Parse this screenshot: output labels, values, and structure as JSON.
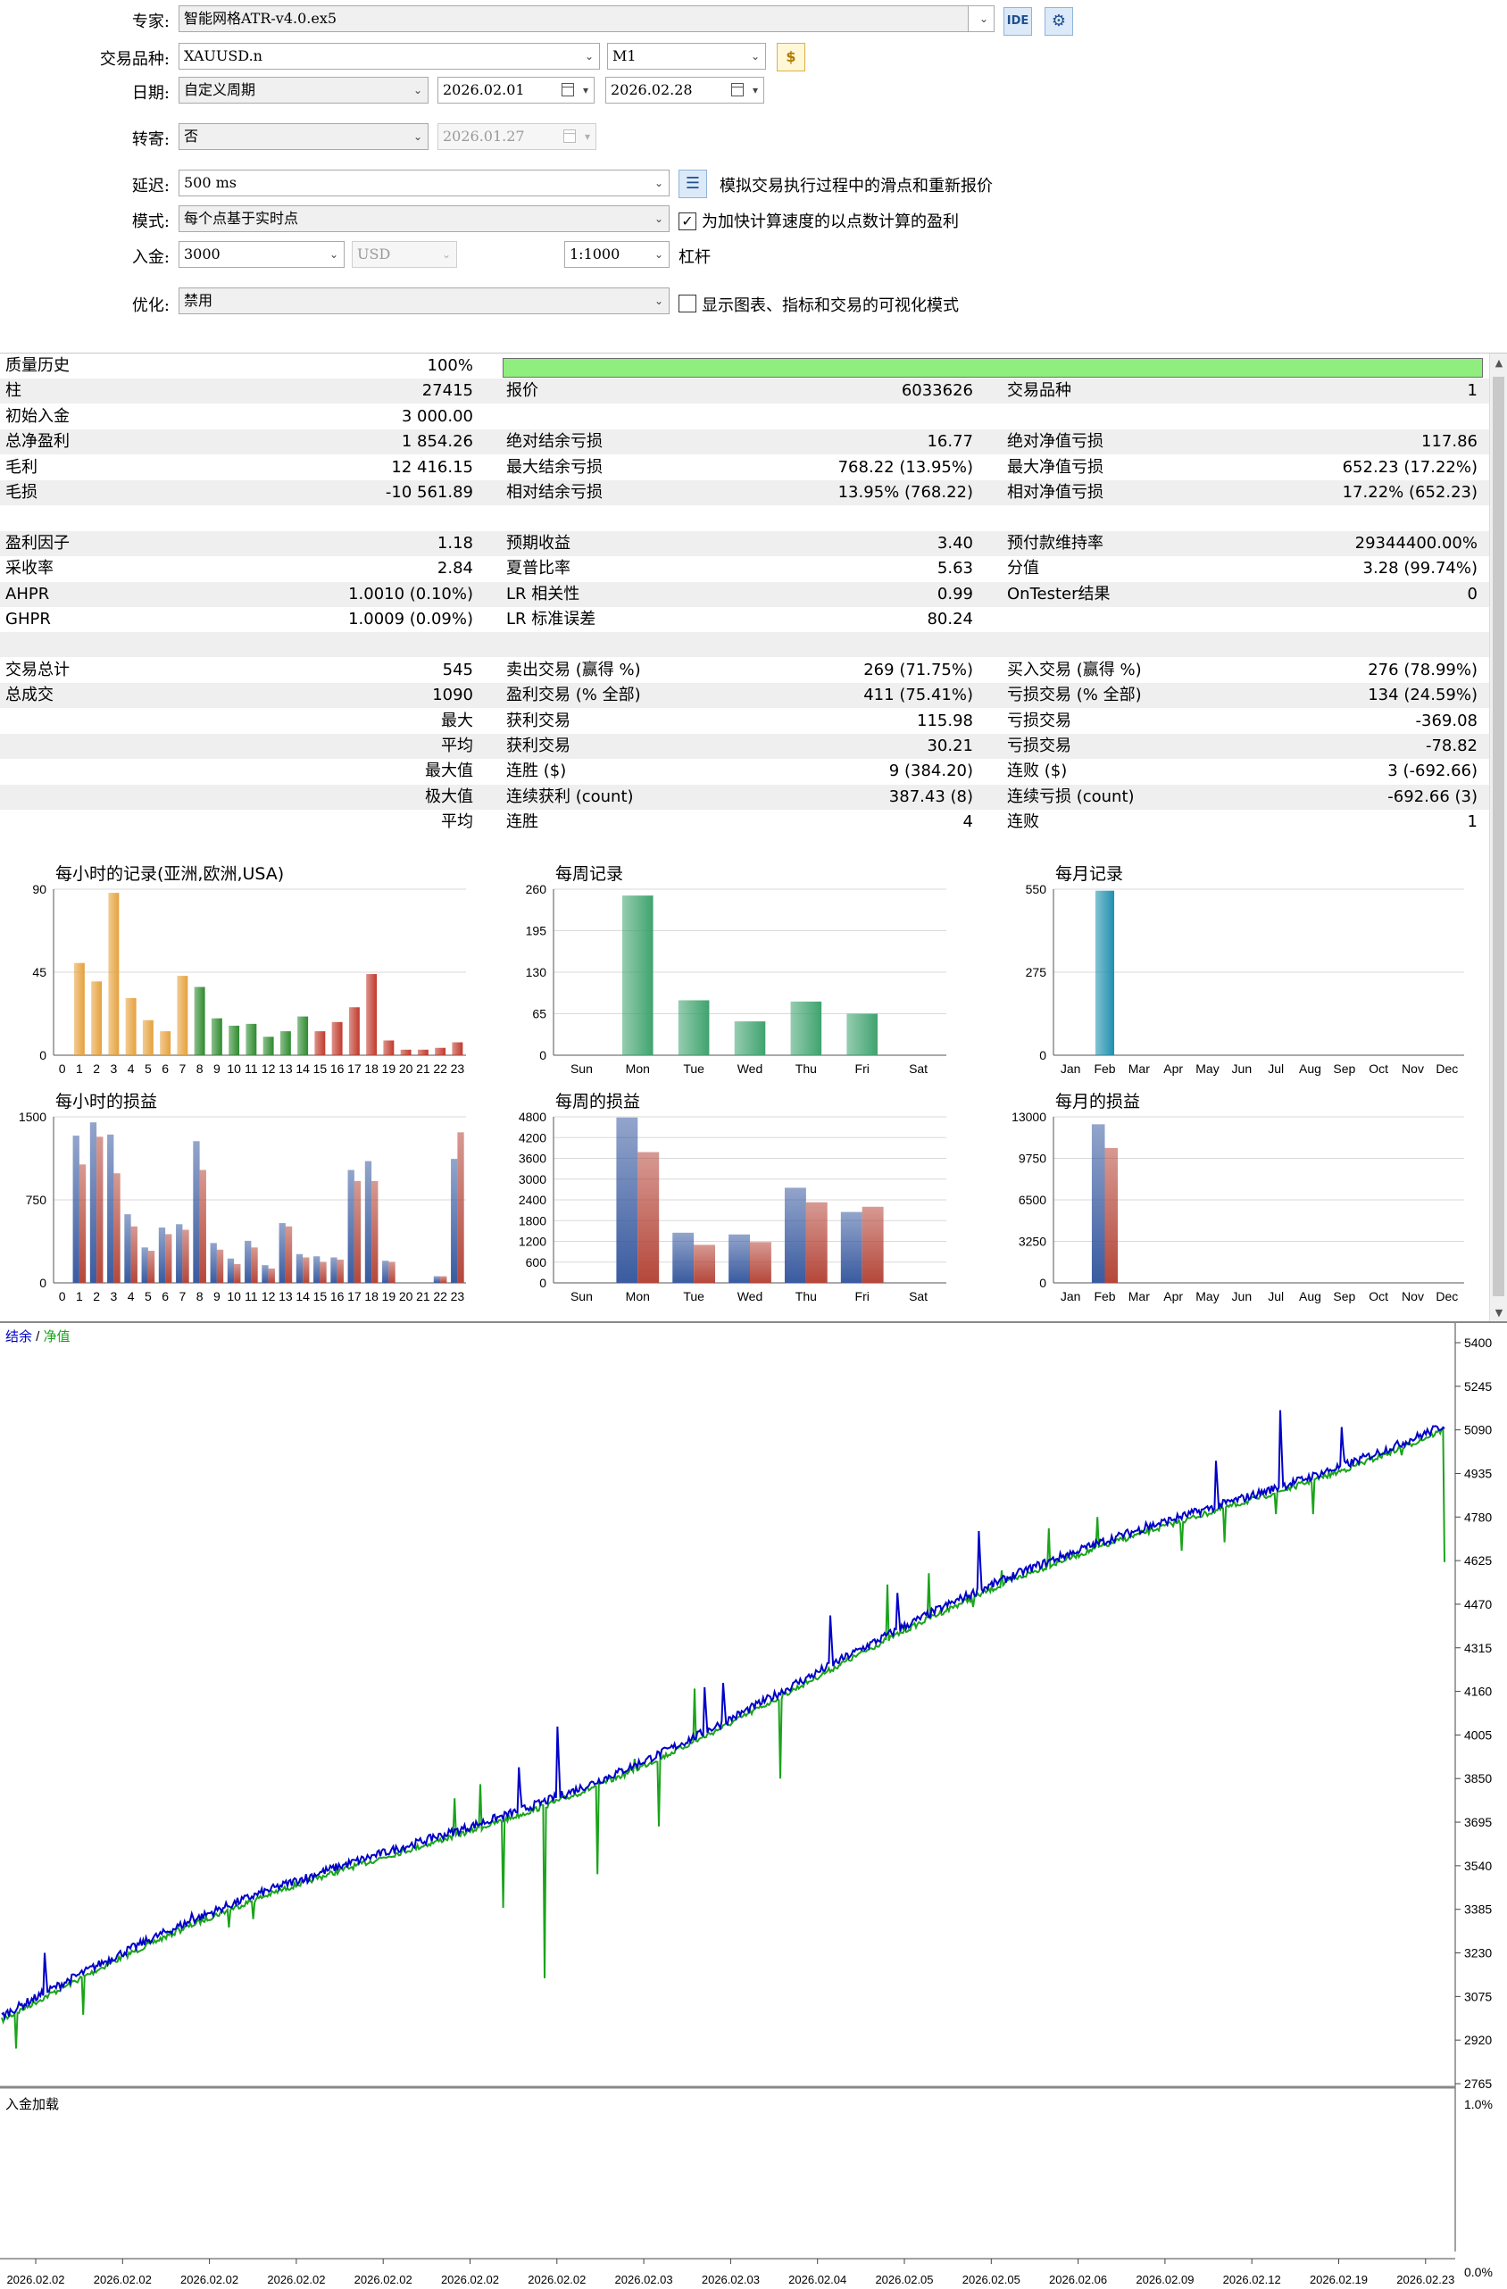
{
  "settings": {
    "expert_label": "专家:",
    "expert_value": "智能网格ATR-v4.0.ex5",
    "ide_label": "IDE",
    "symbol_label": "交易品种:",
    "symbol_value": "XAUUSD.n",
    "timeframe_value": "M1",
    "date_label": "日期:",
    "date_mode": "自定义周期",
    "date_from": "2026.02.01",
    "date_to": "2026.02.28",
    "forward_label": "转寄:",
    "forward_value": "否",
    "forward_date": "2026.01.27",
    "delay_label": "延迟:",
    "delay_value": "500 ms",
    "delay_desc": "模拟交易执行过程中的滑点和重新报价",
    "model_label": "模式:",
    "model_value": "每个点基于实时点",
    "model_check_label": "为加快计算速度的以点数计算的盈利",
    "model_checked": true,
    "deposit_label": "入金:",
    "deposit_value": "3000",
    "currency_value": "USD",
    "leverage_value": "1:1000",
    "leverage_label": "杠杆",
    "optimization_label": "优化:",
    "optimization_value": "禁用",
    "visual_label": "显示图表、指标和交易的可视化模式",
    "visual_checked": false
  },
  "stats": {
    "quality": {
      "label": "质量历史",
      "value": "100%",
      "fill": 1.0
    },
    "rows": [
      {
        "c1l": "柱",
        "c1v": "27415",
        "c2l": "报价",
        "c2v": "6033626",
        "c3l": "交易品种",
        "c3v": "1"
      },
      {
        "c1l": "初始入金",
        "c1v": "3 000.00",
        "c2l": "",
        "c2v": "",
        "c3l": "",
        "c3v": ""
      },
      {
        "c1l": "总净盈利",
        "c1v": "1 854.26",
        "c2l": "绝对结余亏损",
        "c2v": "16.77",
        "c3l": "绝对净值亏损",
        "c3v": "117.86"
      },
      {
        "c1l": "毛利",
        "c1v": "12 416.15",
        "c2l": "最大结余亏损",
        "c2v": "768.22 (13.95%)",
        "c3l": "最大净值亏损",
        "c3v": "652.23 (17.22%)"
      },
      {
        "c1l": "毛损",
        "c1v": "-10 561.89",
        "c2l": "相对结余亏损",
        "c2v": "13.95% (768.22)",
        "c3l": "相对净值亏损",
        "c3v": "17.22% (652.23)"
      },
      {
        "c1l": "",
        "c1v": "",
        "c2l": "",
        "c2v": "",
        "c3l": "",
        "c3v": ""
      },
      {
        "c1l": "盈利因子",
        "c1v": "1.18",
        "c2l": "预期收益",
        "c2v": "3.40",
        "c3l": "预付款维持率",
        "c3v": "29344400.00%"
      },
      {
        "c1l": "采收率",
        "c1v": "2.84",
        "c2l": "夏普比率",
        "c2v": "5.63",
        "c3l": "分值",
        "c3v": "3.28 (99.74%)"
      },
      {
        "c1l": "AHPR",
        "c1v": "1.0010 (0.10%)",
        "c2l": "LR 相关性",
        "c2v": "0.99",
        "c3l": "OnTester结果",
        "c3v": "0"
      },
      {
        "c1l": "GHPR",
        "c1v": "1.0009 (0.09%)",
        "c2l": "LR 标准误差",
        "c2v": "80.24",
        "c3l": "",
        "c3v": ""
      },
      {
        "c1l": "",
        "c1v": "",
        "c2l": "",
        "c2v": "",
        "c3l": "",
        "c3v": ""
      },
      {
        "c1l": "交易总计",
        "c1v": "545",
        "c2l": "卖出交易 (赢得 %)",
        "c2v": "269 (71.75%)",
        "c3l": "买入交易 (赢得 %)",
        "c3v": "276 (78.99%)"
      },
      {
        "c1l": "总成交",
        "c1v": "1090",
        "c2l": "盈利交易 (% 全部)",
        "c2v": "411 (75.41%)",
        "c3l": "亏损交易 (% 全部)",
        "c3v": "134 (24.59%)"
      },
      {
        "c1l": "",
        "c1v": "最大",
        "c2l": "获利交易",
        "c2v": "115.98",
        "c3l": "亏损交易",
        "c3v": "-369.08"
      },
      {
        "c1l": "",
        "c1v": "平均",
        "c2l": "获利交易",
        "c2v": "30.21",
        "c3l": "亏损交易",
        "c3v": "-78.82"
      },
      {
        "c1l": "",
        "c1v": "最大值",
        "c2l": "连胜 ($)",
        "c2v": "9 (384.20)",
        "c3l": "连败 ($)",
        "c3v": "3 (-692.66)"
      },
      {
        "c1l": "",
        "c1v": "极大值",
        "c2l": "连续获利 (count)",
        "c2v": "387.43 (8)",
        "c3l": "连续亏损 (count)",
        "c3v": "-692.66 (3)"
      },
      {
        "c1l": "",
        "c1v": "平均",
        "c2l": "连胜",
        "c2v": "4",
        "c3l": "连败",
        "c3v": "1"
      }
    ]
  },
  "chart_data": [
    {
      "type": "bar",
      "title": "每小时的记录(亚洲,欧洲,USA)",
      "categories": [
        "0",
        "1",
        "2",
        "3",
        "4",
        "5",
        "6",
        "7",
        "8",
        "9",
        "10",
        "11",
        "12",
        "13",
        "14",
        "15",
        "16",
        "17",
        "18",
        "19",
        "20",
        "21",
        "22",
        "23"
      ],
      "yticks": [
        "0",
        "45",
        "90"
      ],
      "ylim": [
        0,
        90
      ],
      "values": [
        0,
        50,
        40,
        88,
        31,
        19,
        13,
        43,
        37,
        20,
        16,
        17,
        10,
        13,
        21,
        13,
        18,
        26,
        44,
        8,
        3,
        3,
        4,
        7
      ],
      "colors": [
        "#e5a13c",
        "#e5a13c",
        "#e5a13c",
        "#e5a13c",
        "#e5a13c",
        "#e5a13c",
        "#e5a13c",
        "#e5a13c",
        "#2e8a2e",
        "#2e8a2e",
        "#2e8a2e",
        "#2e8a2e",
        "#2e8a2e",
        "#2e8a2e",
        "#2e8a2e",
        "#c0392b",
        "#c0392b",
        "#c0392b",
        "#c0392b",
        "#c0392b",
        "#c0392b",
        "#c0392b",
        "#c0392b",
        "#c0392b"
      ]
    },
    {
      "type": "bar",
      "title": "每周记录",
      "categories": [
        "Sun",
        "Mon",
        "Tue",
        "Wed",
        "Thu",
        "Fri",
        "Sat"
      ],
      "yticks": [
        "0",
        "65",
        "130",
        "195",
        "260"
      ],
      "ylim": [
        0,
        260
      ],
      "values": [
        0,
        250,
        86,
        53,
        84,
        65,
        0
      ],
      "colors": [
        "#3fa36e",
        "#3fa36e",
        "#3fa36e",
        "#3fa36e",
        "#3fa36e",
        "#3fa36e",
        "#3fa36e"
      ]
    },
    {
      "type": "bar",
      "title": "每月记录",
      "categories": [
        "Jan",
        "Feb",
        "Mar",
        "Apr",
        "May",
        "Jun",
        "Jul",
        "Aug",
        "Sep",
        "Oct",
        "Nov",
        "Dec"
      ],
      "yticks": [
        "0",
        "275",
        "550"
      ],
      "ylim": [
        0,
        550
      ],
      "values": [
        0,
        545,
        0,
        0,
        0,
        0,
        0,
        0,
        0,
        0,
        0,
        0
      ],
      "colors": [
        "#1f8fae",
        "#1f8fae",
        "#1f8fae",
        "#1f8fae",
        "#1f8fae",
        "#1f8fae",
        "#1f8fae",
        "#1f8fae",
        "#1f8fae",
        "#1f8fae",
        "#1f8fae",
        "#1f8fae"
      ]
    },
    {
      "type": "bar",
      "title": "每小时的损益",
      "categories": [
        "0",
        "1",
        "2",
        "3",
        "4",
        "5",
        "6",
        "7",
        "8",
        "9",
        "10",
        "11",
        "12",
        "13",
        "14",
        "15",
        "16",
        "17",
        "18",
        "19",
        "20",
        "21",
        "22",
        "23"
      ],
      "yticks": [
        "0",
        "750",
        "1500"
      ],
      "ylim": [
        0,
        1500
      ],
      "series": [
        {
          "name": "",
          "color": "#3a5ba0",
          "values": [
            0,
            1330,
            1450,
            1340,
            620,
            320,
            500,
            530,
            1280,
            360,
            220,
            380,
            160,
            540,
            260,
            240,
            230,
            1020,
            1100,
            200,
            0,
            0,
            60,
            1120
          ]
        },
        {
          "name": "",
          "color": "#b5473a",
          "values": [
            0,
            1070,
            1320,
            990,
            510,
            290,
            440,
            480,
            1020,
            300,
            170,
            320,
            130,
            510,
            230,
            190,
            210,
            920,
            920,
            190,
            0,
            0,
            60,
            1360
          ]
        }
      ]
    },
    {
      "type": "bar",
      "title": "每周的损益",
      "categories": [
        "Sun",
        "Mon",
        "Tue",
        "Wed",
        "Thu",
        "Fri",
        "Sat"
      ],
      "yticks": [
        "0",
        "600",
        "1200",
        "1800",
        "2400",
        "3000",
        "3600",
        "4200",
        "4800"
      ],
      "ylim": [
        0,
        4800
      ],
      "series": [
        {
          "name": "",
          "color": "#3a5ba0",
          "values": [
            0,
            4780,
            1450,
            1400,
            2750,
            2050,
            0
          ]
        },
        {
          "name": "",
          "color": "#b5473a",
          "values": [
            0,
            3780,
            1100,
            1180,
            2330,
            2200,
            0
          ]
        }
      ]
    },
    {
      "type": "bar",
      "title": "每月的损益",
      "categories": [
        "Jan",
        "Feb",
        "Mar",
        "Apr",
        "May",
        "Jun",
        "Jul",
        "Aug",
        "Sep",
        "Oct",
        "Nov",
        "Dec"
      ],
      "yticks": [
        "0",
        "3250",
        "6500",
        "9750",
        "13000"
      ],
      "ylim": [
        0,
        13000
      ],
      "series": [
        {
          "name": "",
          "color": "#3a5ba0",
          "values": [
            0,
            12416,
            0,
            0,
            0,
            0,
            0,
            0,
            0,
            0,
            0,
            0
          ]
        },
        {
          "name": "",
          "color": "#b5473a",
          "values": [
            0,
            10562,
            0,
            0,
            0,
            0,
            0,
            0,
            0,
            0,
            0,
            0
          ]
        }
      ]
    },
    {
      "type": "line",
      "title": "结余 / 净值",
      "legend": [
        {
          "name": "结余",
          "color": "#0000c8"
        },
        {
          "name": "净值",
          "color": "#1aa41a"
        }
      ],
      "ylim": [
        2765,
        5400
      ],
      "yticks": [
        "5400",
        "5245",
        "5090",
        "4935",
        "4780",
        "4625",
        "4470",
        "4315",
        "4160",
        "4005",
        "3850",
        "3695",
        "3540",
        "3385",
        "3230",
        "3075",
        "2920",
        "2765"
      ],
      "xticks": [
        "2026.02.02",
        "2026.02.02",
        "2026.02.02",
        "2026.02.02",
        "2026.02.02",
        "2026.02.02",
        "2026.02.02",
        "2026.02.03",
        "2026.02.03",
        "2026.02.04",
        "2026.02.05",
        "2026.02.05",
        "2026.02.06",
        "2026.02.09",
        "2026.02.12",
        "2026.02.19",
        "2026.02.23"
      ],
      "x": [
        0,
        545
      ],
      "balance_start": 3000,
      "balance_end": 4854,
      "equity_dips": [
        {
          "x": 10,
          "y": 2890
        },
        {
          "x": 57,
          "y": 3010
        },
        {
          "x": 123,
          "y": 3320
        },
        {
          "x": 159,
          "y": 3320
        },
        {
          "x": 176,
          "y": 3350
        },
        {
          "x": 200,
          "y": 3460
        },
        {
          "x": 248,
          "y": 3540
        },
        {
          "x": 317,
          "y": 3780
        },
        {
          "x": 335,
          "y": 3830
        },
        {
          "x": 351,
          "y": 3390
        },
        {
          "x": 380,
          "y": 3140
        },
        {
          "x": 417,
          "y": 3510
        },
        {
          "x": 443,
          "y": 3920
        },
        {
          "x": 460,
          "y": 3680
        },
        {
          "x": 485,
          "y": 4170
        },
        {
          "x": 545,
          "y": 3850
        },
        {
          "x": 620,
          "y": 4540
        },
        {
          "x": 649,
          "y": 4580
        },
        {
          "x": 680,
          "y": 4460
        },
        {
          "x": 700,
          "y": 4590
        },
        {
          "x": 733,
          "y": 4740
        },
        {
          "x": 767,
          "y": 4780
        },
        {
          "x": 826,
          "y": 4660
        },
        {
          "x": 856,
          "y": 4690
        },
        {
          "x": 892,
          "y": 4790
        },
        {
          "x": 918,
          "y": 4790
        },
        {
          "x": 952,
          "y": 4975
        },
        {
          "x": 980,
          "y": 5000
        },
        {
          "x": 1010,
          "y": 4620
        }
      ],
      "balance_spikes": [
        {
          "x": 30,
          "y": 3230
        },
        {
          "x": 133,
          "y": 3370
        },
        {
          "x": 214,
          "y": 3480
        },
        {
          "x": 302,
          "y": 3650
        },
        {
          "x": 362,
          "y": 3890
        },
        {
          "x": 389,
          "y": 4035
        },
        {
          "x": 492,
          "y": 4175
        },
        {
          "x": 505,
          "y": 4190
        },
        {
          "x": 556,
          "y": 4200
        },
        {
          "x": 580,
          "y": 4430
        },
        {
          "x": 627,
          "y": 4510
        },
        {
          "x": 684,
          "y": 4730
        },
        {
          "x": 751,
          "y": 4650
        },
        {
          "x": 801,
          "y": 4760
        },
        {
          "x": 850,
          "y": 4980
        },
        {
          "x": 895,
          "y": 5160
        },
        {
          "x": 938,
          "y": 5100
        }
      ]
    }
  ],
  "deposit_load": {
    "label": "入金加载",
    "yticks": [
      "1.0%",
      "0.0%"
    ]
  }
}
